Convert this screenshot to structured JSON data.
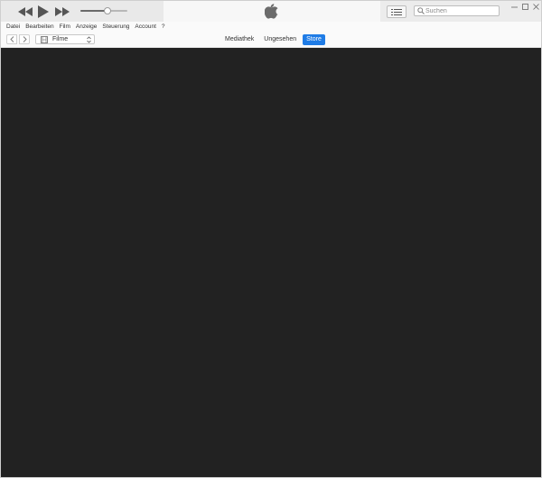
{
  "playback": {
    "volume_level": 0.58
  },
  "colors": {
    "accent": "#1f7ce6",
    "content_bg": "#222222"
  },
  "search": {
    "placeholder": "Suchen"
  },
  "menu": [
    "Datei",
    "Bearbeiten",
    "Film",
    "Anzeige",
    "Steuerung",
    "Account",
    "?"
  ],
  "media_selector": {
    "selected": "Filme"
  },
  "tabs": [
    {
      "label": "Mediathek",
      "active": false
    },
    {
      "label": "Ungesehen",
      "active": false
    },
    {
      "label": "Store",
      "active": true
    }
  ]
}
